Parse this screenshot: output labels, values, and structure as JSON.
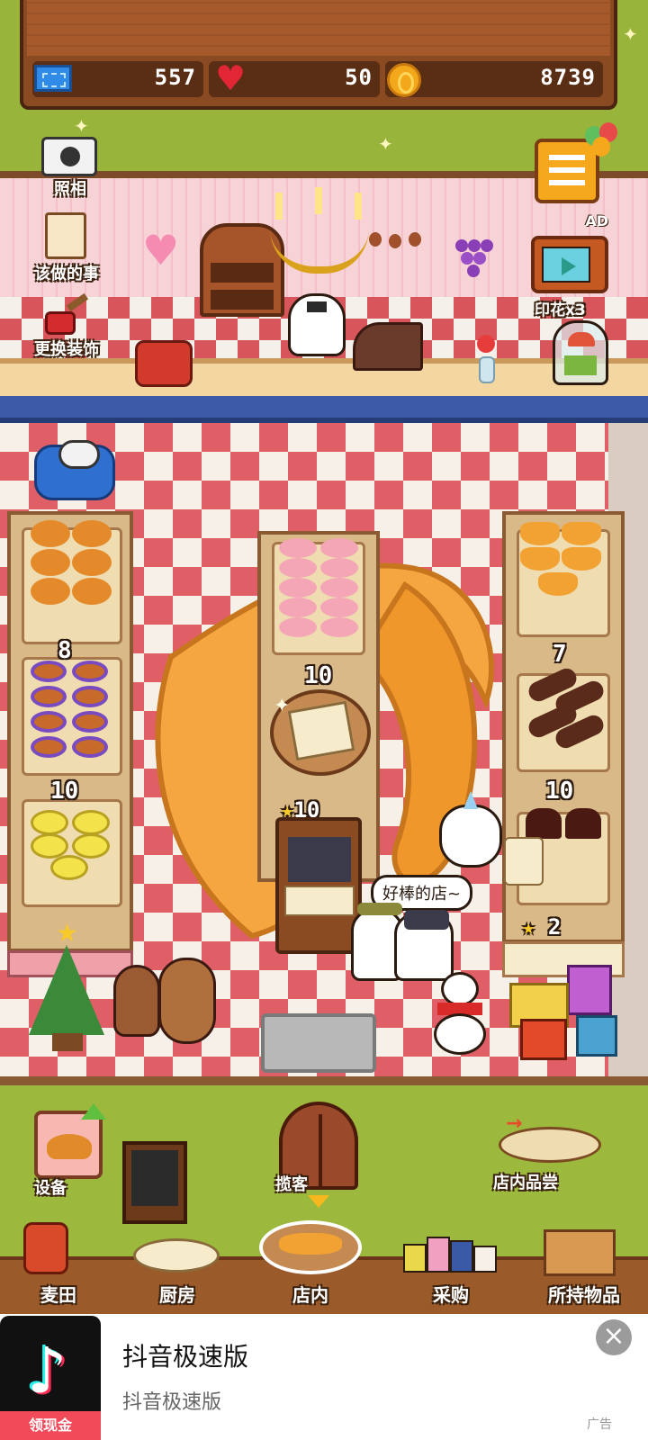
{
  "resources": {
    "tickets": "557",
    "hearts": "50",
    "coins": "8739"
  },
  "left_menu": {
    "photo": "照相",
    "todo": "该做的事",
    "decor": "更换装饰"
  },
  "right_menu": {
    "stamp": "印花x3",
    "ad_badge": "AD"
  },
  "shelves": {
    "left": {
      "count_mid": "8",
      "count_bottom": "10"
    },
    "center": {
      "count_mid": "10",
      "stars": "10"
    },
    "right": {
      "count_mid": "7",
      "count_bottom": "10",
      "stars": "2"
    }
  },
  "speech_bubble": "好棒的店~",
  "actions": {
    "equipment": "设备",
    "attract": "揽客",
    "tasting": "店内品尝"
  },
  "bottom_nav": [
    {
      "label": "麦田"
    },
    {
      "label": "厨房"
    },
    {
      "label": "店内"
    },
    {
      "label": "采购"
    },
    {
      "label": "所持物品"
    }
  ],
  "ad": {
    "title": "抖音极速版",
    "subtitle": "抖音极速版",
    "cash_label": "领现金",
    "tag": "广告",
    "close": "×"
  },
  "colors": {
    "floor_red": "#e05f67",
    "floor_white": "#f6f0e9",
    "lawn": "#9cb93d",
    "wood": "#9a5a2a"
  }
}
